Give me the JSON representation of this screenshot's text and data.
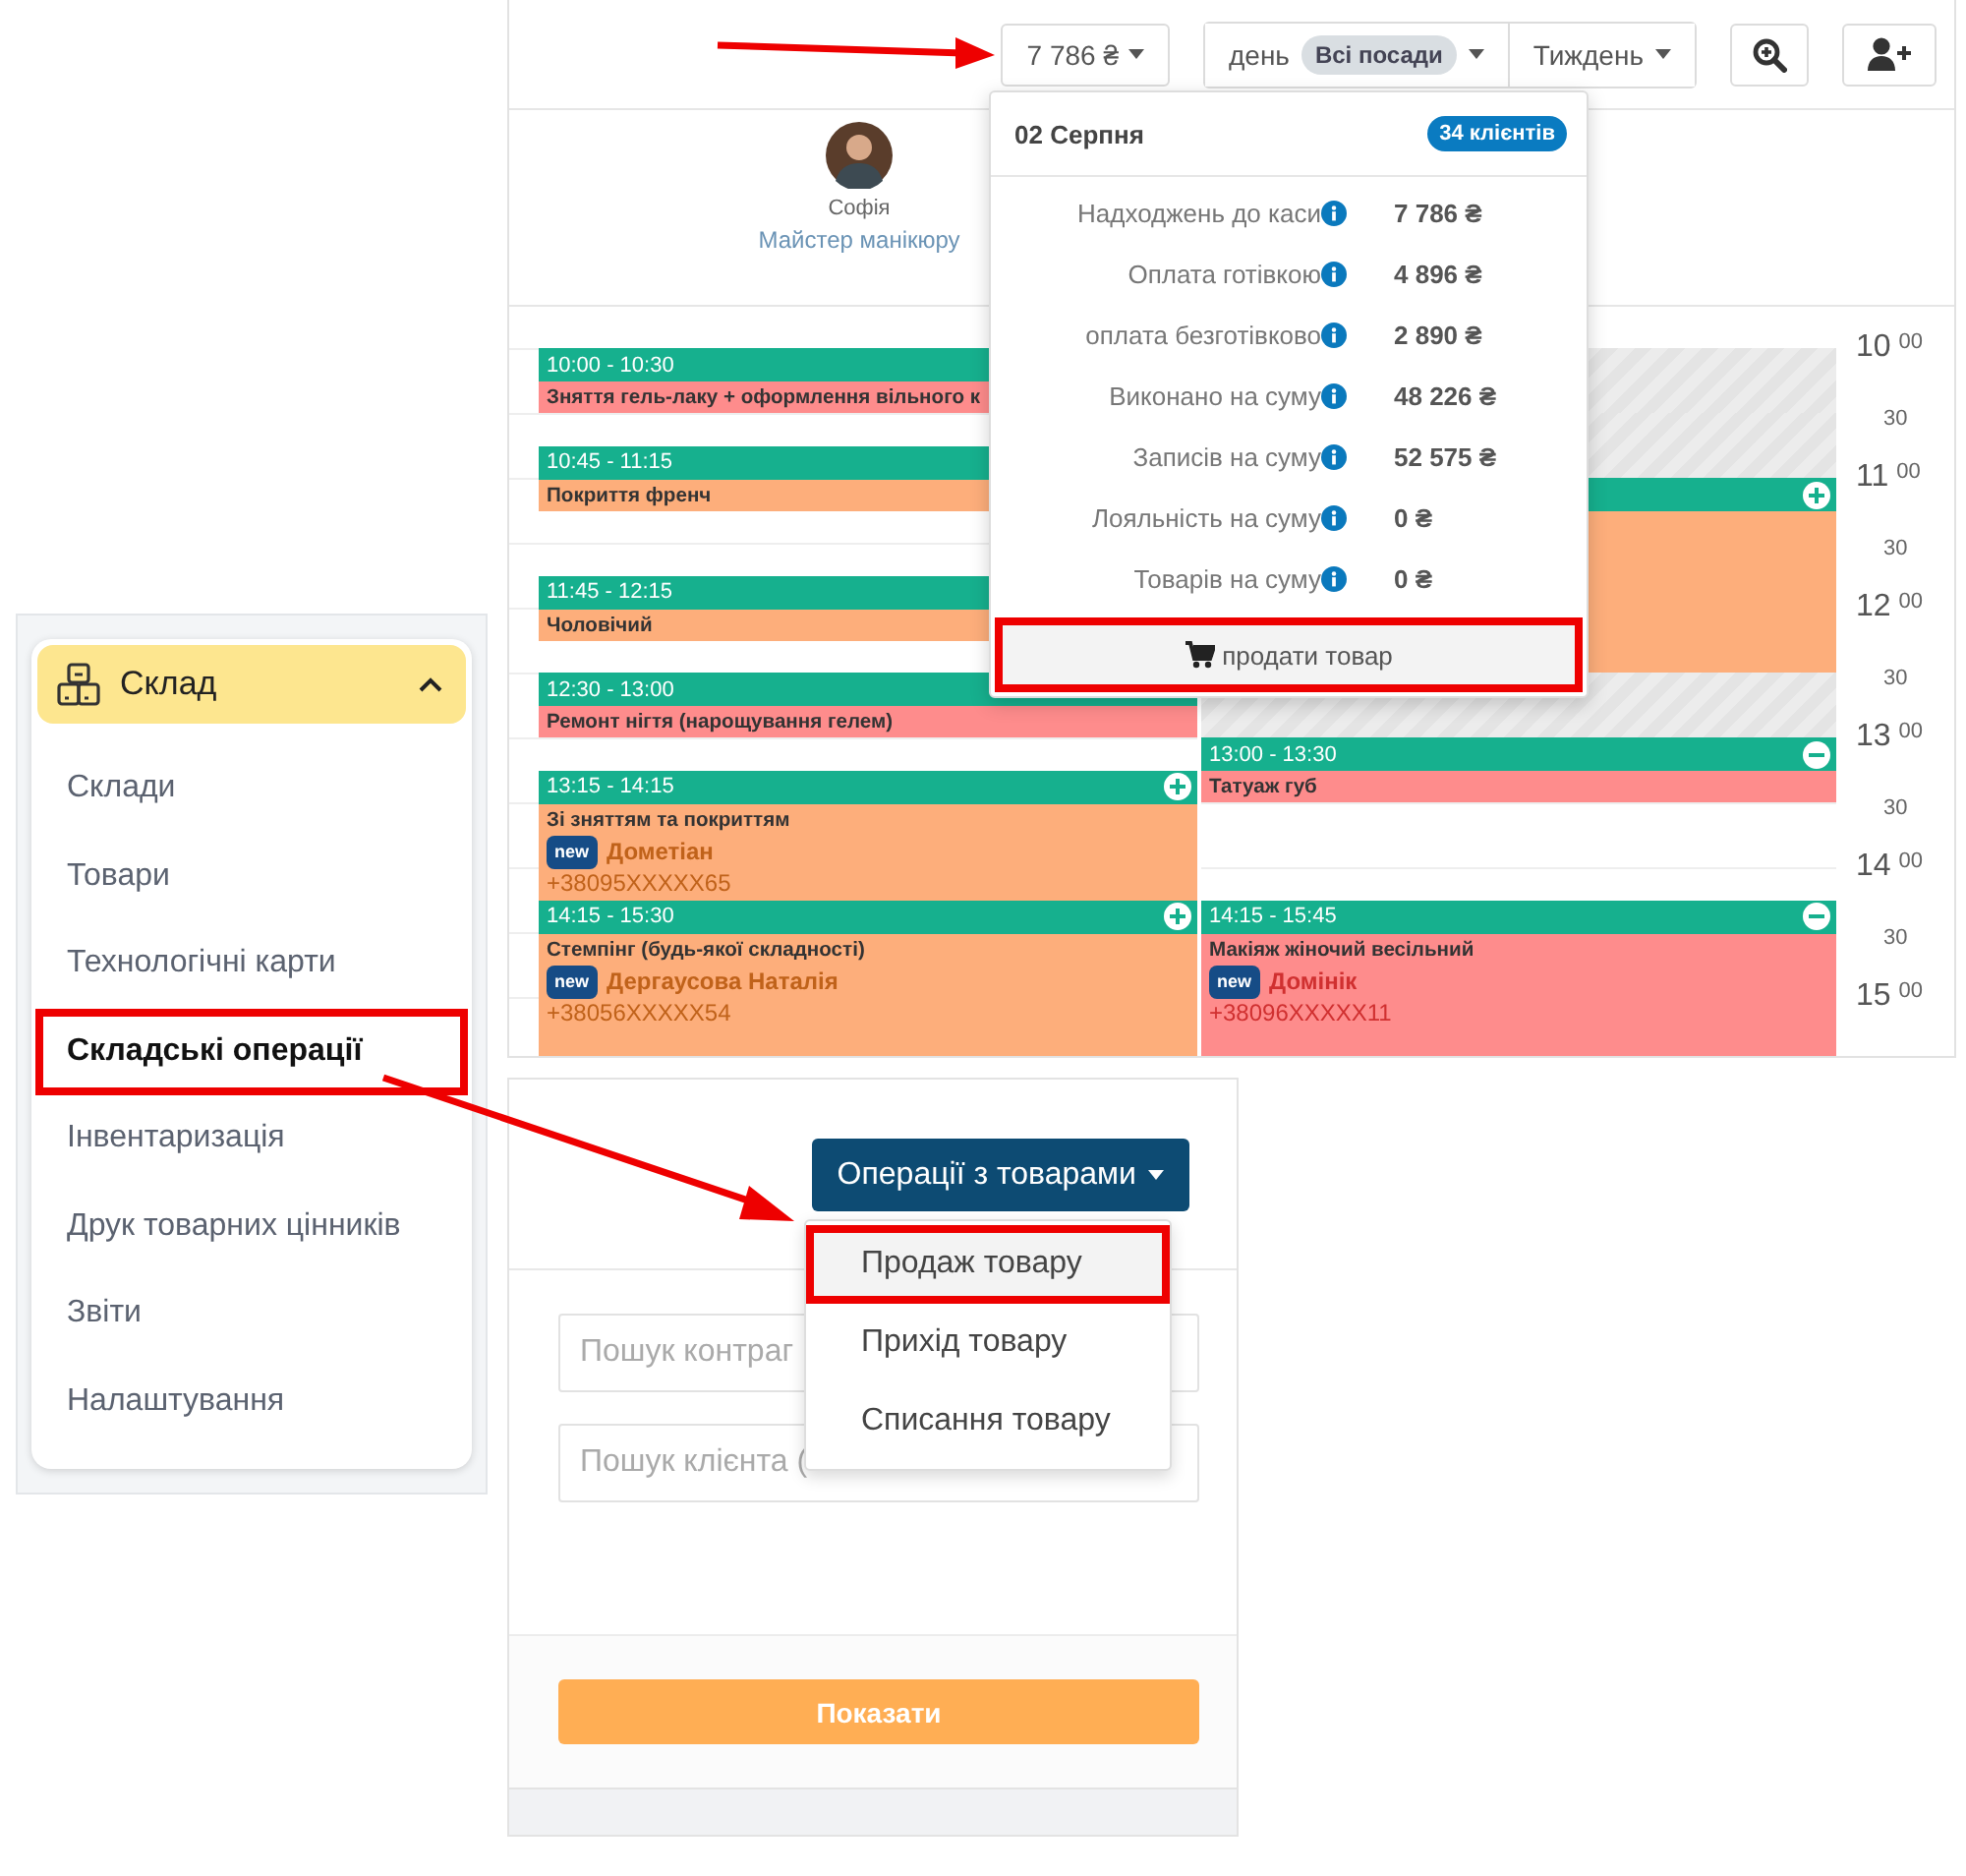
{
  "calendar": {
    "toolbar": {
      "cash_total": "7 786 ₴",
      "view": "день",
      "position_filter": "Всі посади",
      "period": "Тиждень"
    },
    "staff": {
      "name": "Софія",
      "role": "Майстер манікюру"
    },
    "time_slots": [
      {
        "hour": "10",
        "minutes": "00"
      },
      {
        "minutes": "30"
      },
      {
        "hour": "11",
        "minutes": "00"
      },
      {
        "minutes": "30"
      },
      {
        "hour": "12",
        "minutes": "00"
      },
      {
        "minutes": "30"
      },
      {
        "hour": "13",
        "minutes": "00"
      },
      {
        "minutes": "30"
      },
      {
        "hour": "14",
        "minutes": "00"
      },
      {
        "minutes": "30"
      },
      {
        "hour": "15",
        "minutes": "00"
      }
    ],
    "columns": [
      {
        "events": [
          {
            "kind": "plain",
            "time": "10:00 - 10:30",
            "title": "Зняття гель-лаку + оформлення вільного к",
            "color": "#fe8c8c"
          },
          {
            "kind": "plain",
            "time": "10:45 - 11:15",
            "title": "Покриття френч",
            "color": "#fdae7b"
          },
          {
            "kind": "plain",
            "time": "11:45 - 12:15",
            "title": "Чоловічий",
            "color": "#fdae7b"
          },
          {
            "kind": "plain",
            "time": "12:30 - 13:00",
            "title": "Ремонт нігтя (нарощування гелем)",
            "color": "#fe8c8c"
          },
          {
            "kind": "plus",
            "time": "13:15 - 14:15",
            "title": "Зі зняттям та покриттям",
            "badge": "new",
            "client": "Дометіан",
            "phone": "+38095XXXXX65",
            "color": "#fdae7b"
          },
          {
            "kind": "plus",
            "time": "14:15 - 15:30",
            "title": "Стемпінг (будь-якої складності)",
            "badge": "new",
            "client": "Дергаусова Наталія",
            "phone": "+38056XXXXX54",
            "color": "#fdae7b"
          }
        ]
      },
      {
        "slots": [
          {
            "kind": "blocked"
          },
          {
            "kind": "blocked"
          },
          {
            "kind": "booked"
          },
          {
            "kind": "booked"
          },
          {
            "kind": "booked"
          },
          {
            "kind": "blocked"
          }
        ],
        "events": [
          {
            "kind": "minus",
            "time": "13:00 - 13:30",
            "title": "Татуаж губ",
            "color": "#fe8c8c"
          },
          {
            "kind": "minus",
            "time": "14:15 - 15:45",
            "title": "Макіяж жіночий весільний",
            "badge": "new",
            "client": "Домінік",
            "phone": "+38096XXXXX11",
            "color": "#fe8c8c"
          }
        ]
      }
    ],
    "summary_popup": {
      "date": "02 Серпня",
      "clients_badge": "34 клієнтів",
      "rows": [
        {
          "label": "Надходжень до каси",
          "value": "7 786 ₴"
        },
        {
          "label": "Оплата готівкою",
          "value": "4 896 ₴"
        },
        {
          "label": "оплата безготівково",
          "value": "2 890 ₴"
        },
        {
          "label": "Виконано на суму",
          "value": "48 226 ₴"
        },
        {
          "label": "Записів на суму",
          "value": "52 575 ₴"
        },
        {
          "label": "Лояльність на суму",
          "value": "0 ₴"
        },
        {
          "label": "Товарів на суму",
          "value": "0 ₴"
        }
      ],
      "sell_button": {
        "label": "продати товар",
        "highlighted": true
      }
    }
  },
  "sidebar": {
    "section": {
      "label": "Склад",
      "expanded": true
    },
    "items": [
      {
        "label": "Склади",
        "selected": false,
        "highlighted": false
      },
      {
        "label": "Товари",
        "selected": false,
        "highlighted": false
      },
      {
        "label": "Технологічні карти",
        "selected": false,
        "highlighted": false
      },
      {
        "label": "Складські операції",
        "selected": true,
        "highlighted": true
      },
      {
        "label": "Інвентаризація",
        "selected": false,
        "highlighted": false
      },
      {
        "label": "Друк товарних цінників",
        "selected": false,
        "highlighted": false
      },
      {
        "label": "Звіти",
        "selected": false,
        "highlighted": false
      },
      {
        "label": "Налаштування",
        "selected": false,
        "highlighted": false
      }
    ]
  },
  "operations_panel": {
    "menu_button": "Операції з товарами",
    "menu_items": [
      {
        "label": "Продаж товару",
        "highlighted": true
      },
      {
        "label": "Прихід товару",
        "highlighted": false
      },
      {
        "label": "Списання товару",
        "highlighted": false
      }
    ],
    "fields": [
      {
        "placeholder": "Пошук контраг"
      },
      {
        "placeholder": "Пошук клієнта ("
      }
    ],
    "show_button": "Показати"
  }
}
